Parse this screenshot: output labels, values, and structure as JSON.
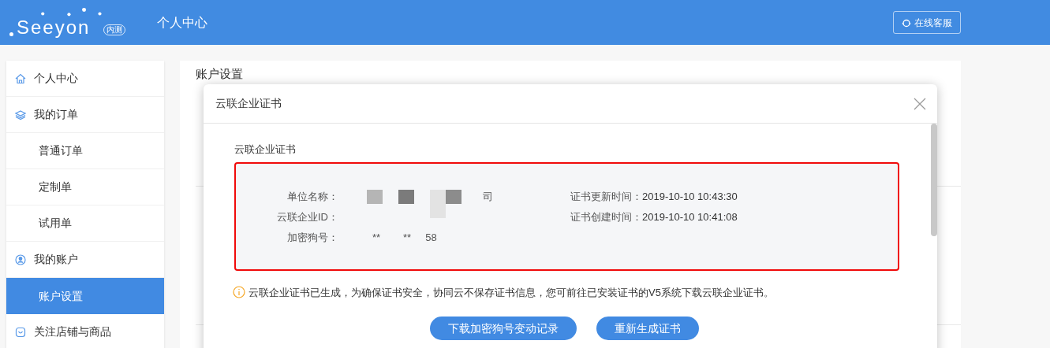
{
  "header": {
    "logo": "Seeyon",
    "logo_badge": "内测",
    "title": "个人中心",
    "service_button": "在线客服"
  },
  "sidebar": {
    "items": [
      {
        "label": "个人中心",
        "kind": "section",
        "selected": false
      },
      {
        "label": "我的订单",
        "kind": "section",
        "selected": false
      },
      {
        "label": "普通订单",
        "kind": "sub",
        "selected": false
      },
      {
        "label": "定制单",
        "kind": "sub",
        "selected": false
      },
      {
        "label": "试用单",
        "kind": "sub",
        "selected": false
      },
      {
        "label": "我的账户",
        "kind": "section",
        "selected": false
      },
      {
        "label": "账户设置",
        "kind": "sub",
        "selected": true
      },
      {
        "label": "关注店铺与商品",
        "kind": "section",
        "selected": false
      }
    ]
  },
  "main": {
    "title": "账户设置"
  },
  "dialog": {
    "title": "云联企业证书",
    "section_title": "云联企业证书",
    "left_fields": [
      {
        "label": "单位名称：",
        "value": "司"
      },
      {
        "label": "云联企业ID："
      },
      {
        "label": "加密狗号：",
        "value": "**        **     58"
      }
    ],
    "right_fields": [
      {
        "label": "证书更新时间：",
        "value": "2019-10-10 10:43:30"
      },
      {
        "label": "证书创建时间：",
        "value": "2019-10-10 10:41:08"
      }
    ],
    "notice": "云联企业证书已生成，为确保证书安全，协同云不保存证书信息，您可前往已安装证书的V5系统下载云联企业证书。",
    "buttons": [
      "下载加密狗号变动记录",
      "重新生成证书"
    ]
  }
}
